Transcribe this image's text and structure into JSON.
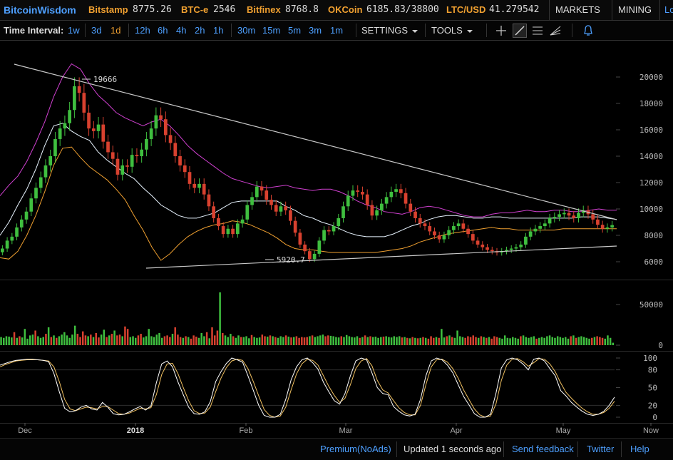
{
  "header": {
    "brand": "BitcoinWisdom",
    "tickers": [
      {
        "exchange": "Bitstamp",
        "value": "8775.26"
      },
      {
        "exchange": "BTC-e",
        "value": "2546"
      },
      {
        "exchange": "Bitfinex",
        "value": "8768.8"
      },
      {
        "exchange": "OKCoin",
        "value": "6185.83/38800"
      },
      {
        "exchange": "LTC/USD",
        "value": "41.279542"
      }
    ],
    "menus": {
      "markets": "MARKETS",
      "mining": "MINING",
      "login": "Lo"
    }
  },
  "toolbar": {
    "time_interval_label": "Time Interval:",
    "intervals": [
      "1w",
      "3d",
      "1d",
      "12h",
      "6h",
      "4h",
      "2h",
      "1h",
      "30m",
      "15m",
      "5m",
      "3m",
      "1m"
    ],
    "active_interval": "1d",
    "settings": "SETTINGS",
    "tools": "TOOLS",
    "tool_icons": [
      "crosshair-icon",
      "trend-line-icon",
      "horizontal-lines-icon",
      "fan-icon",
      "alarm-bell-icon"
    ]
  },
  "colors": {
    "up": "#3fbf3f",
    "down": "#d8412f",
    "bb_upper": "#d040d0",
    "bb_lower": "#f0a030",
    "ma": "#e8f4ff",
    "k_line": "#ffffff",
    "d_line": "#f0c060",
    "link": "#4ea0ff",
    "accent": "#f0a030"
  },
  "chart_data": [
    {
      "type": "line",
      "name": "price",
      "x_labels": [
        "Dec",
        "2018",
        "Feb",
        "Mar",
        "Apr",
        "May",
        "Now"
      ],
      "ylim": [
        5000,
        21500
      ],
      "y_ticks": [
        "20000",
        "18000",
        "16000",
        "14000",
        "12000",
        "10000",
        "8000",
        "6000"
      ],
      "annotations": [
        {
          "label": "19666"
        },
        {
          "label": "5920.7"
        }
      ],
      "close": [
        7000,
        7600,
        7900,
        8600,
        9200,
        9800,
        10800,
        11600,
        12400,
        13300,
        14000,
        15300,
        16100,
        16500,
        17500,
        19300,
        18800,
        17300,
        16100,
        15900,
        16400,
        15100,
        14300,
        13800,
        12600,
        13300,
        13200,
        14100,
        14000,
        14500,
        15300,
        16100,
        17100,
        16800,
        15600,
        15000,
        14000,
        13300,
        12800,
        11900,
        11600,
        11900,
        11100,
        10200,
        9300,
        8700,
        8100,
        8500,
        8100,
        8900,
        9200,
        10300,
        10900,
        11700,
        11400,
        10700,
        10300,
        9800,
        10200,
        9900,
        9100,
        8200,
        7300,
        6800,
        6200,
        6600,
        7600,
        8400,
        8300,
        8700,
        9300,
        10200,
        11000,
        11400,
        11300,
        11100,
        10300,
        9500,
        9900,
        10400,
        10900,
        11300,
        11500,
        11200,
        10400,
        9800,
        9300,
        8900,
        8700,
        8300,
        8000,
        7700,
        8000,
        8400,
        8700,
        8900,
        8500,
        8100,
        7600,
        7300,
        7100,
        6900,
        6800,
        6700,
        6800,
        6900,
        7000,
        7100,
        7300,
        7900,
        8300,
        8500,
        8700,
        8900,
        9300,
        9400,
        9600,
        9700,
        9500,
        9300,
        9700,
        9900,
        9600,
        9200,
        8800,
        8500,
        8600,
        8775
      ],
      "bb_upper": [
        11000,
        11800,
        12500,
        13600,
        15000,
        16600,
        18500,
        20000,
        21000,
        20600,
        19500,
        18600,
        18000,
        17300,
        16900,
        16600,
        16300,
        16600,
        16800,
        16300,
        15600,
        14800,
        14200,
        13700,
        13200,
        12700,
        12300,
        12100,
        11900,
        11700,
        11600,
        11700,
        11800,
        11600,
        11500,
        11400,
        11500,
        11500,
        11300,
        11000,
        10600,
        10300,
        10100,
        9800,
        9700,
        9600,
        9800,
        10100,
        10200,
        10100,
        9900,
        9700,
        9500,
        9400,
        9400,
        9600,
        9700,
        9700,
        9800,
        9900,
        9800,
        9800,
        9900,
        9900,
        9800,
        9800,
        9900,
        10000,
        9900,
        9900
      ],
      "ma": [
        8000,
        9000,
        10300,
        11500,
        13000,
        14800,
        16300,
        16500,
        15900,
        15500,
        15200,
        14300,
        13700,
        13200,
        12700,
        12300,
        11600,
        11000,
        10300,
        9900,
        9500,
        9300,
        9300,
        9500,
        9700,
        10100,
        10500,
        10600,
        10600,
        10600,
        10600,
        10600,
        10200,
        9900,
        9500,
        9300,
        9000,
        8800,
        8500,
        8200,
        8000,
        7900,
        7900,
        7900,
        8100,
        8400,
        8700,
        8900,
        9200,
        9400,
        9500,
        9500,
        9400,
        9300,
        9300,
        9400,
        9400,
        9300,
        9300,
        9300,
        9300,
        9300,
        9300,
        9300,
        9300,
        9400,
        9400,
        9400,
        9300,
        9200
      ],
      "bb_lower": [
        6300,
        6200,
        6800,
        8000,
        9500,
        11300,
        13300,
        14600,
        14700,
        13900,
        13200,
        12700,
        12200,
        11500,
        10700,
        9500,
        8400,
        7100,
        6100,
        6600,
        7300,
        7900,
        8300,
        8600,
        8800,
        8900,
        9100,
        9000,
        8800,
        8500,
        8200,
        7800,
        7300,
        7000,
        6900,
        6900,
        6800,
        6700,
        6700,
        6700,
        6700,
        6700,
        6700,
        6800,
        6900,
        7000,
        7200,
        7500,
        7700,
        7900,
        8100,
        8200,
        8300,
        8400,
        8500,
        8600,
        8500,
        8500,
        8400,
        8400,
        8400,
        8400,
        8400,
        8500,
        8500,
        8500,
        8500,
        8500,
        8500,
        8500
      ]
    },
    {
      "type": "bar",
      "name": "volume",
      "y_ticks": [
        "50000",
        "0"
      ],
      "values": [
        10000,
        9000,
        11000,
        10500,
        9500,
        16000,
        9000,
        11000,
        9500,
        20000,
        8000,
        12000,
        13000,
        18000,
        11000,
        9000,
        10000,
        14000,
        22000,
        10000,
        12000,
        9000,
        11000,
        13000,
        16000,
        12000,
        9000,
        13000,
        24000,
        14000,
        10000,
        17000,
        12000,
        11000,
        13000,
        10000,
        15000,
        9500,
        13000,
        19000,
        10000,
        12000,
        14000,
        18000,
        12000,
        13000,
        11000,
        23000,
        20000,
        10000,
        11000,
        9000,
        12000,
        14000,
        9500,
        11000,
        20000,
        11000,
        10000,
        13000,
        15000,
        9000,
        11000,
        12000,
        10000,
        14000,
        22000,
        13000,
        10000,
        9000,
        11000,
        10000,
        8000,
        12000,
        10500,
        9000,
        15000,
        11000,
        16000,
        8500,
        22000,
        12000,
        18000,
        65000,
        15000,
        12000,
        10000,
        14000,
        11000,
        9000,
        12000,
        10000,
        10000,
        11000,
        8500,
        12500,
        10000,
        9000,
        9500,
        13000,
        11000,
        10500,
        12000,
        11000,
        10000,
        9000,
        11000,
        10000,
        12000,
        10500,
        9500,
        10000,
        11000,
        9000,
        10000,
        9500,
        10000,
        11000,
        12000,
        10000,
        11000,
        12000,
        13000,
        11000,
        12000,
        11500,
        11000,
        10000,
        9500,
        11000,
        10000,
        12500,
        11000,
        10000,
        9500,
        11000,
        9000,
        10000,
        12000,
        10000,
        11000,
        10000,
        10500,
        9000,
        10000,
        10500,
        11000,
        10000,
        9500,
        11000,
        10000,
        11000,
        9500,
        10000,
        9000,
        8500,
        10000,
        9000,
        8500,
        9000,
        10000,
        9000,
        8000,
        11000,
        9000,
        10000,
        9000,
        20000,
        9500,
        11000,
        12000,
        10000,
        9000,
        18000,
        11000,
        10000,
        9000,
        11000,
        10000,
        12000,
        10000,
        9000,
        11000,
        10000,
        9000,
        10000,
        8000,
        11000,
        10000,
        9000,
        8000,
        12000,
        9000,
        8500,
        10000,
        9000,
        8000,
        11000,
        12000,
        10000,
        9000,
        10000,
        11000,
        8000,
        9000,
        10000,
        9000,
        11000,
        12000,
        10000,
        9000,
        11000,
        10000,
        9000,
        10000,
        8000,
        11000,
        12000,
        9000,
        10000,
        11000,
        10000,
        9000,
        8000,
        9000,
        10000,
        11000,
        10000,
        9000,
        8000,
        12000,
        9000,
        3000
      ]
    },
    {
      "type": "line",
      "name": "stochastic",
      "ylim": [
        0,
        100
      ],
      "y_ticks": [
        "100",
        "80",
        "50",
        "20",
        "0"
      ],
      "k": [
        88,
        91,
        94,
        96,
        97,
        98,
        98,
        97,
        96,
        94,
        74,
        43,
        15,
        9,
        11,
        17,
        20,
        14,
        12,
        25,
        17,
        6,
        4,
        5,
        9,
        14,
        18,
        12,
        19,
        58,
        90,
        95,
        85,
        60,
        38,
        17,
        6,
        5,
        9,
        26,
        60,
        77,
        91,
        100,
        97,
        93,
        70,
        45,
        20,
        3,
        0,
        0,
        5,
        30,
        63,
        85,
        97,
        100,
        92,
        81,
        59,
        43,
        28,
        22,
        40,
        70,
        95,
        100,
        97,
        75,
        50,
        40,
        38,
        18,
        10,
        4,
        2,
        5,
        30,
        70,
        95,
        100,
        97,
        88,
        75,
        55,
        35,
        21,
        6,
        0,
        0,
        5,
        40,
        83,
        97,
        100,
        97,
        90,
        80,
        98,
        100,
        95,
        82,
        70,
        45,
        36,
        25,
        17,
        10,
        5,
        3,
        5,
        10,
        20,
        34
      ],
      "d": [
        85,
        89,
        92,
        95,
        96,
        97,
        97,
        97,
        96,
        95,
        85,
        60,
        30,
        14,
        11,
        14,
        17,
        16,
        14,
        18,
        18,
        12,
        6,
        5,
        7,
        11,
        15,
        14,
        16,
        38,
        72,
        90,
        91,
        74,
        50,
        28,
        11,
        6,
        7,
        17,
        43,
        66,
        84,
        95,
        98,
        96,
        82,
        60,
        36,
        13,
        3,
        0,
        2,
        17,
        46,
        73,
        90,
        98,
        96,
        88,
        70,
        52,
        37,
        25,
        32,
        55,
        82,
        95,
        99,
        87,
        62,
        46,
        41,
        28,
        16,
        8,
        4,
        4,
        20,
        55,
        85,
        97,
        98,
        93,
        82,
        66,
        46,
        30,
        14,
        4,
        0,
        2,
        22,
        62,
        88,
        98,
        99,
        94,
        86,
        92,
        99,
        98,
        90,
        77,
        58,
        42,
        32,
        23,
        15,
        9,
        5,
        5,
        8,
        15,
        27
      ],
      "x_labels": [
        "Dec",
        "2018",
        "Feb",
        "Mar",
        "Apr",
        "May",
        "Now"
      ]
    }
  ],
  "footer": {
    "premium": "Premium(NoAds)",
    "updated": "Updated 1 seconds ago",
    "feedback": "Send feedback",
    "twitter": "Twitter",
    "help": "Help"
  }
}
